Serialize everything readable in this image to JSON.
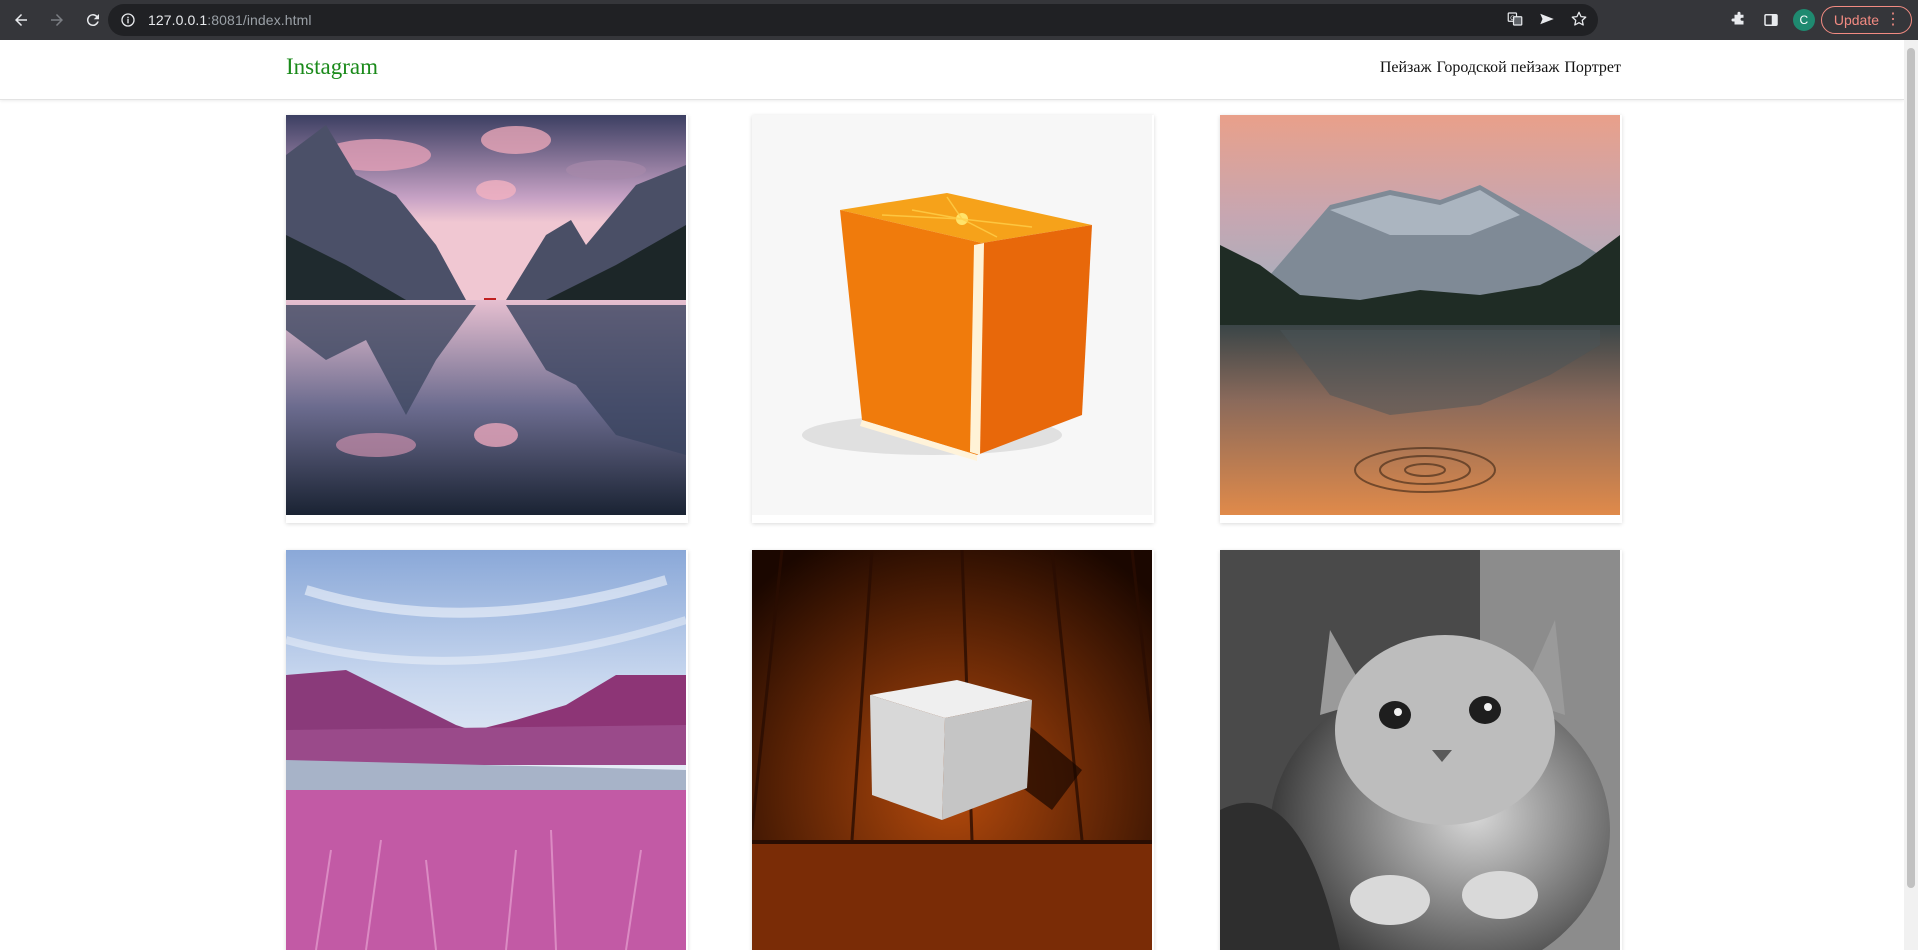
{
  "browser": {
    "url_host": "127.0.0.1",
    "url_rest": ":8081/index.html",
    "profile_initial": "C",
    "update_label": "Update"
  },
  "site": {
    "brand": "Instagram",
    "brand_color": "#1a8a1a",
    "menu": [
      {
        "label": "Пейзаж"
      },
      {
        "label": "Городской пейзаж"
      },
      {
        "label": "Портрет"
      }
    ]
  },
  "gallery": [
    {
      "subject": "mountain-lake-reflection-photo"
    },
    {
      "subject": "orange-cube-photo"
    },
    {
      "subject": "sunset-mountain-lake-photo"
    },
    {
      "subject": "pink-valley-landscape-photo"
    },
    {
      "subject": "stone-cube-on-wooden-floor-photo"
    },
    {
      "subject": "kitten-bw-portrait-photo"
    }
  ]
}
